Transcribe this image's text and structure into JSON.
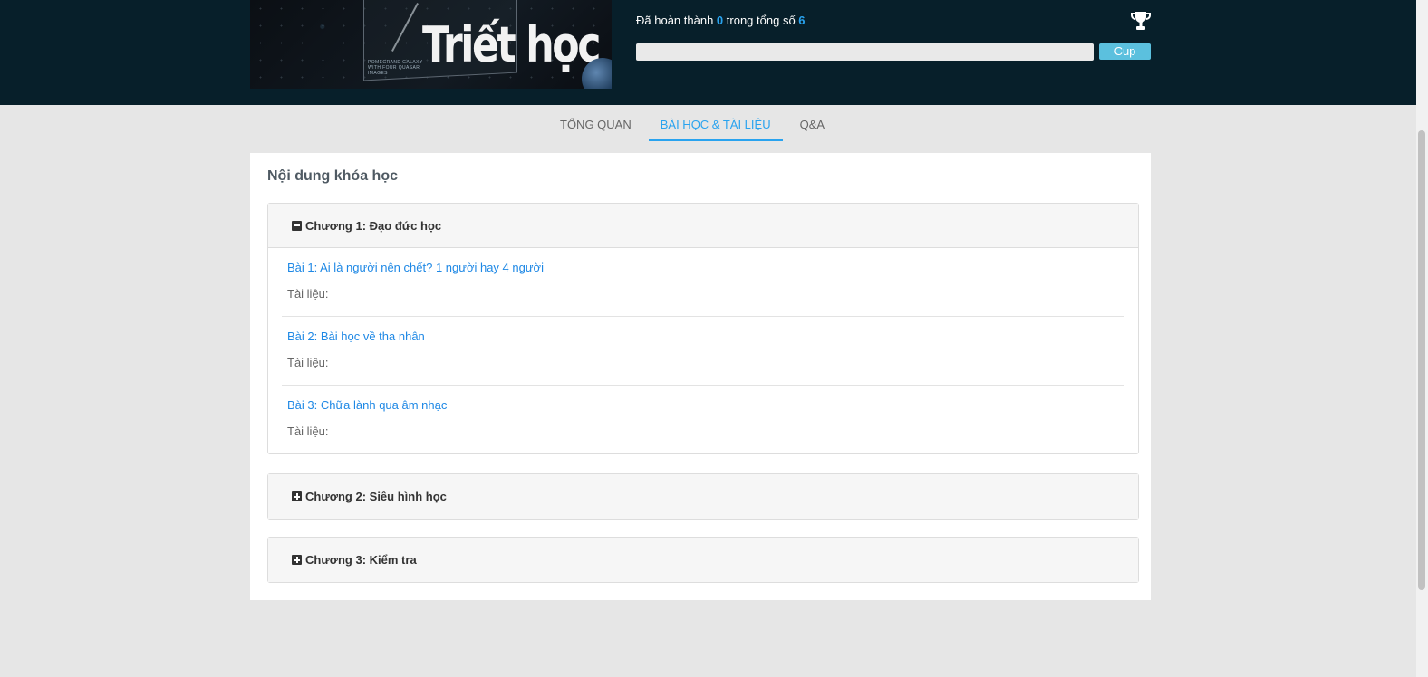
{
  "banner": {
    "title": "Triết học",
    "caption": "POMEGRAND GALAXY WITH FOUR QUASAR IMAGES"
  },
  "progress": {
    "prefix": "Đã hoàn thành",
    "completed": "0",
    "middle": "trong tổng số",
    "total": "6",
    "fraction": 0,
    "cup_label": "Cup"
  },
  "tabs": [
    {
      "label": "TỔNG QUAN",
      "active": false
    },
    {
      "label": "BÀI HỌC & TÀI LIỆU",
      "active": true
    },
    {
      "label": "Q&A",
      "active": false
    }
  ],
  "content": {
    "title": "Nội dung khóa học",
    "chapters": [
      {
        "title": "Chương 1: Đạo đức học",
        "expanded": true,
        "lessons": [
          {
            "title": "Bài 1: Ai là người nên chết? 1 người hay 4 người",
            "docs_label": "Tài liệu:"
          },
          {
            "title": "Bài 2: Bài học về tha nhân",
            "docs_label": "Tài liệu:"
          },
          {
            "title": "Bài 3: Chữa lành qua âm nhạc",
            "docs_label": "Tài liệu:"
          }
        ]
      },
      {
        "title": "Chương 2: Siêu hình học",
        "expanded": false
      },
      {
        "title": "Chương 3: Kiểm tra",
        "expanded": false
      }
    ]
  },
  "colors": {
    "header_bg": "#071f2a",
    "accent": "#29a3ef",
    "cup_button": "#5bc0de",
    "link": "#1e88e5"
  }
}
